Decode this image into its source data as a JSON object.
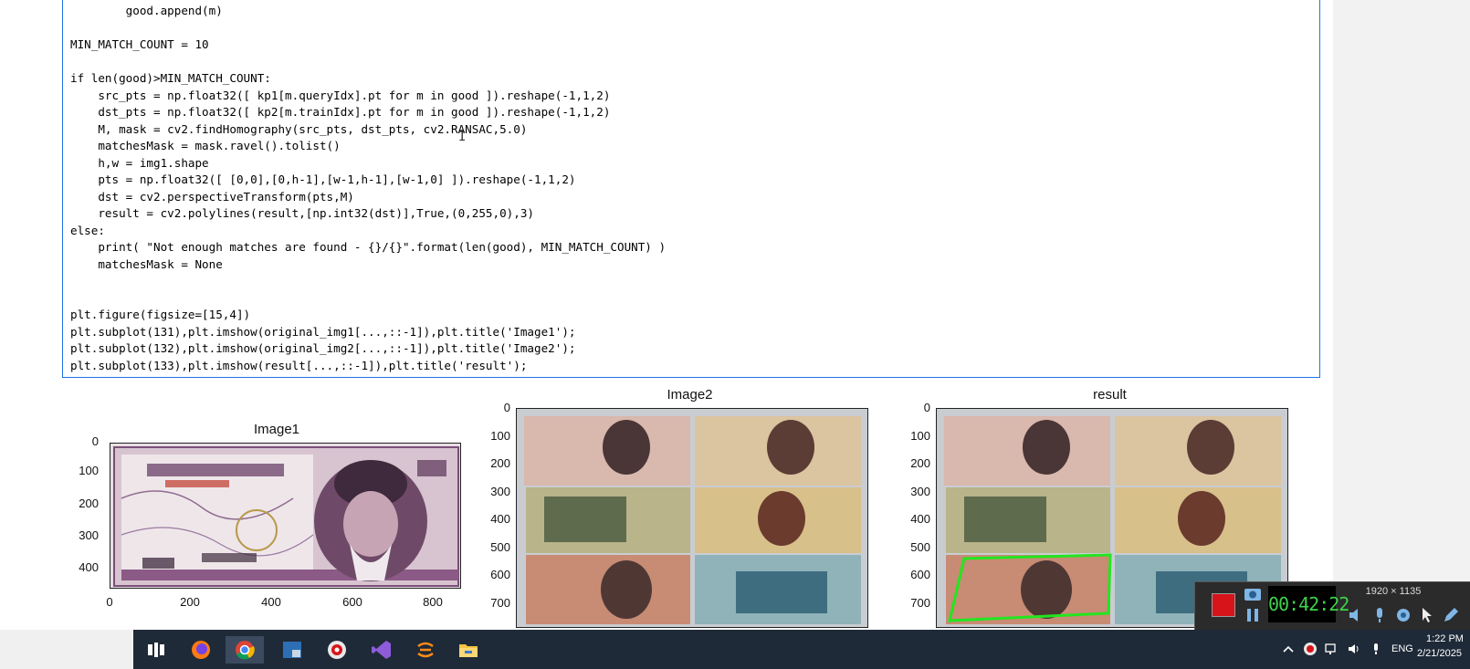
{
  "code_lines": [
    "        good.append(m)",
    "",
    "MIN_MATCH_COUNT = 10",
    "",
    "if len(good)>MIN_MATCH_COUNT:",
    "    src_pts = np.float32([ kp1[m.queryIdx].pt for m in good ]).reshape(-1,1,2)",
    "    dst_pts = np.float32([ kp2[m.trainIdx].pt for m in good ]).reshape(-1,1,2)",
    "    M, mask = cv2.findHomography(src_pts, dst_pts, cv2.RANSAC,5.0)",
    "    matchesMask = mask.ravel().tolist()",
    "    h,w = img1.shape",
    "    pts = np.float32([ [0,0],[0,h-1],[w-1,h-1],[w-1,0] ]).reshape(-1,1,2)",
    "    dst = cv2.perspectiveTransform(pts,M)",
    "    result = cv2.polylines(result,[np.int32(dst)],True,(0,255,0),3)",
    "else:",
    "    print( \"Not enough matches are found - {}/{}\".format(len(good), MIN_MATCH_COUNT) )",
    "    matchesMask = None",
    "",
    "",
    "plt.figure(figsize=[15,4])",
    "plt.subplot(131),plt.imshow(original_img1[...,::-1]),plt.title('Image1');",
    "plt.subplot(132),plt.imshow(original_img2[...,::-1]),plt.title('Image2');",
    "plt.subplot(133),plt.imshow(result[...,::-1]),plt.title('result');"
  ],
  "plots": [
    {
      "title": "Image1",
      "yticks": [
        "0",
        "100",
        "200",
        "300",
        "400"
      ],
      "xticks": [
        "0",
        "200",
        "400",
        "600",
        "800"
      ]
    },
    {
      "title": "Image2",
      "yticks": [
        "0",
        "100",
        "200",
        "300",
        "400",
        "500",
        "600",
        "700"
      ],
      "xticks": []
    },
    {
      "title": "result",
      "yticks": [
        "0",
        "100",
        "200",
        "300",
        "400",
        "500",
        "600",
        "700"
      ],
      "xticks": []
    }
  ],
  "recorder": {
    "resolution": "1920 × 1135",
    "time": "00:42:22"
  },
  "taskbar": {
    "language": "ENG",
    "time": "1:22 PM",
    "date": "2/21/2025"
  },
  "colors": {
    "accent": "#1e73e6",
    "keyword": "#008000",
    "string": "#ba2121",
    "record": "#d7141a",
    "polyline": "#22e61e"
  },
  "icons": [
    "task-view-icon",
    "firefox-icon",
    "chrome-icon",
    "terminal-icon",
    "obs-icon",
    "visual-studio-icon",
    "sublime-icon",
    "file-explorer-icon"
  ]
}
